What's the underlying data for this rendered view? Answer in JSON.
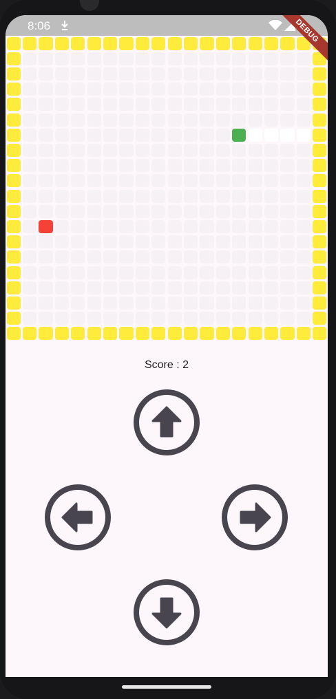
{
  "status_bar": {
    "time": "8:06"
  },
  "debug_banner": "DEBUG",
  "board": {
    "columns": 20,
    "rows": 20,
    "wall_color": "#ffeb3b",
    "empty_color": "#f5f1f5",
    "snake_head": {
      "col": 14,
      "row": 6,
      "color": "#4caf50"
    },
    "snake_body": [
      {
        "col": 15,
        "row": 6
      },
      {
        "col": 16,
        "row": 6
      },
      {
        "col": 17,
        "row": 6
      },
      {
        "col": 18,
        "row": 6
      }
    ],
    "snake_body_color": "#ffffff",
    "food": {
      "col": 2,
      "row": 12,
      "color": "#f44336"
    }
  },
  "score_text": "Score : 2",
  "controls": {
    "color": "#49454f",
    "up": "arrow-up-icon",
    "left": "arrow-left-icon",
    "right": "arrow-right-icon",
    "down": "arrow-down-icon"
  }
}
